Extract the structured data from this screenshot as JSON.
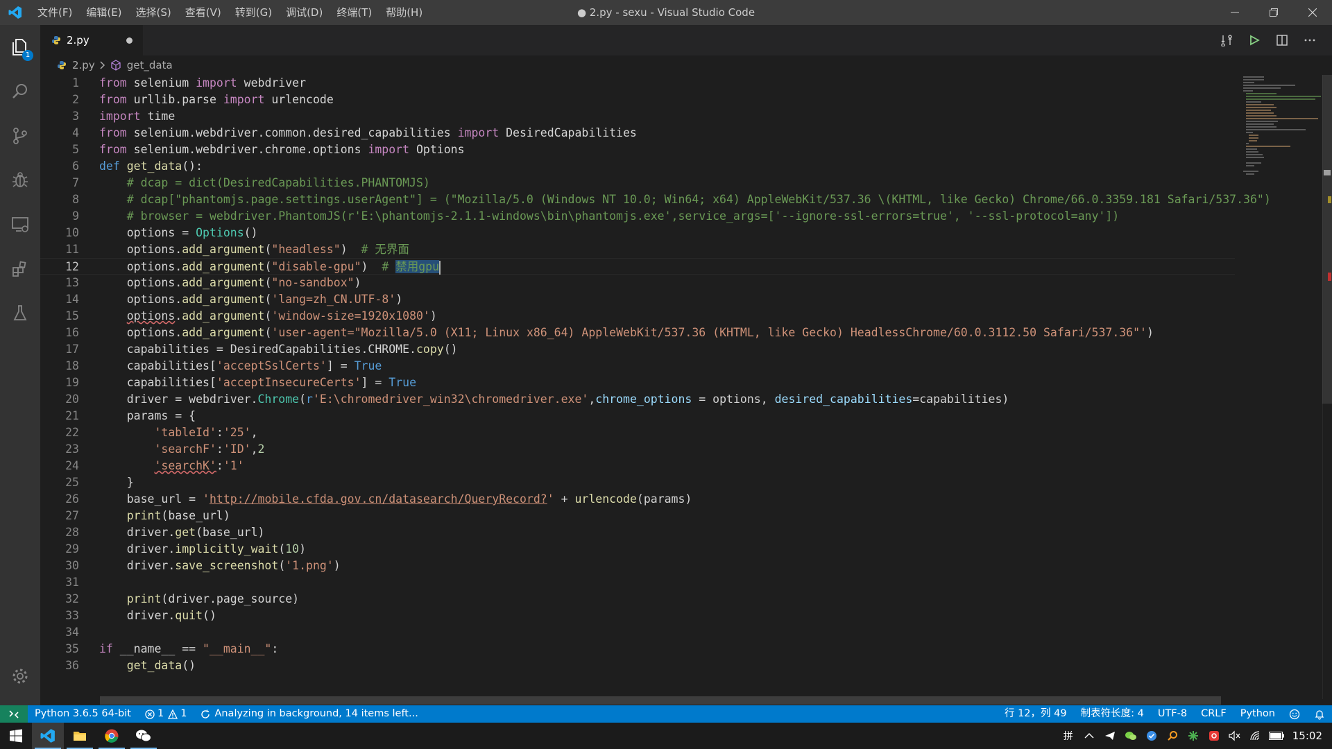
{
  "window": {
    "title": "● 2.py - sexu - Visual Studio Code",
    "menu": [
      "文件(F)",
      "编辑(E)",
      "选择(S)",
      "查看(V)",
      "转到(G)",
      "调试(D)",
      "终端(T)",
      "帮助(H)"
    ]
  },
  "activity": {
    "explorer_badge": "1"
  },
  "tab": {
    "label": "2.py"
  },
  "breadcrumb": {
    "file": "2.py",
    "symbol": "get_data"
  },
  "editor": {
    "line_numbers": [
      "1",
      "2",
      "3",
      "4",
      "5",
      "6",
      "7",
      "8",
      "9",
      "10",
      "11",
      "12",
      "13",
      "14",
      "15",
      "16",
      "17",
      "18",
      "19",
      "20",
      "21",
      "22",
      "23",
      "24",
      "25",
      "26",
      "27",
      "28",
      "29",
      "30",
      "31",
      "32",
      "33",
      "34",
      "35",
      "36"
    ],
    "t": {
      "from": "from",
      "import": "import",
      "def": "def",
      "if": "if",
      "l1": " selenium ",
      "l1b": " webdriver",
      "l2": " urllib.parse ",
      "l2b": " urlencode",
      "l3": " time",
      "l4": " selenium.webdriver.common.desired_capabilities ",
      "l4b": " DesiredCapabilities",
      "l5": " selenium.webdriver.chrome.options ",
      "l5b": " Options",
      "l6fn": "get_data",
      "l6end": "():",
      "l7": "# dcap = dict(DesiredCapabilities.PHANTOMJS)",
      "l8": "# dcap[\"phantomjs.page.settings.userAgent\"] = (\"Mozilla/5.0 (Windows NT 10.0; Win64; x64) AppleWebKit/537.36 \\(KHTML, like Gecko) Chrome/66.0.3359.181 Safari/537.36\")",
      "l9": "# browser = webdriver.PhantomJS(r'E:\\phantomjs-2.1.1-windows\\bin\\phantomjs.exe',service_args=['--ignore-ssl-errors=true', '--ssl-protocol=any'])",
      "l10": "options = ",
      "l10fn": "Options",
      "l10end": "()",
      "oadd": "options.",
      "addarg": "add_argument",
      "lp": "(",
      "rp": ")",
      "s11": "\"headless\"",
      "c11": "  # 无界面",
      "s12": "\"disable-gpu\"",
      "c12a": "  # ",
      "c12sel": "禁用gpu",
      "s13": "\"no-sandbox\"",
      "s14": "'lang=zh_CN.UTF-8'",
      "l15a": "options",
      "s15": "'window-size=1920x1080'",
      "s16": "'user-agent=\"Mozilla/5.0 (X11; Linux x86_64) AppleWebKit/537.36 (KHTML, like Gecko) HeadlessChrome/60.0.3112.50 Safari/537.36\"'",
      "l17": "capabilities = DesiredCapabilities.CHROME.",
      "l17fn": "copy",
      "l17end": "()",
      "cap": "capabilities[",
      "s18": "'acceptSslCerts'",
      "s19": "'acceptInsecureCerts'",
      "eqtrue": "] = ",
      "true": "True",
      "l20a": "driver = webdriver.",
      "l20fn": "Chrome",
      "l20r": "r",
      "s20": "'E:\\chromedriver_win32\\chromedriver.exe'",
      "l20c": ",",
      "p1": "chrome_options",
      "l20d": " = options, ",
      "p2": "desired_capabilities",
      "l20e": "=capabilities)",
      "l21": "params = {",
      "s22k": "'tableId'",
      "colon": ":",
      "s22v": "'25'",
      "comma": ",",
      "s23k": "'searchF'",
      "s23v": "'ID'",
      "n23": "2",
      "s24k": "'searchK'",
      "s24v": "'1'",
      "l25": "}",
      "l26a": "base_url = ",
      "q": "'",
      "s26url": "http://mobile.cfda.gov.cn/datasearch/QueryRecord?",
      "l26b": " + ",
      "l26fn": "urlencode",
      "l26c": "(params)",
      "print": "print",
      "l27": "(base_url)",
      "drv": "driver.",
      "get": "get",
      "l28": "(base_url)",
      "wait": "implicitly_wait",
      "n29": "10",
      "shot": "save_screenshot",
      "s30": "'1.png'",
      "l32": "(driver.page_source)",
      "quit": "quit",
      "l33": "()",
      "l35a": " __name__ == ",
      "s35": "\"__main__\"",
      "l35b": ":",
      "l36": "()"
    }
  },
  "statusbar": {
    "python": "Python 3.6.5 64-bit",
    "errors": "1",
    "warnings": "1",
    "analyzing": "Analyzing in background, 14 items left...",
    "position": "行 12，列 49",
    "tab_size": "制表符长度: 4",
    "encoding": "UTF-8",
    "eol": "CRLF",
    "language": "Python"
  },
  "taskbar": {
    "ime": "拼",
    "clock": "15:02"
  },
  "colors": {
    "accent": "#007acc",
    "remote": "#16825d",
    "keyword": "#c586c0",
    "string": "#ce9178",
    "comment": "#6a9955"
  }
}
